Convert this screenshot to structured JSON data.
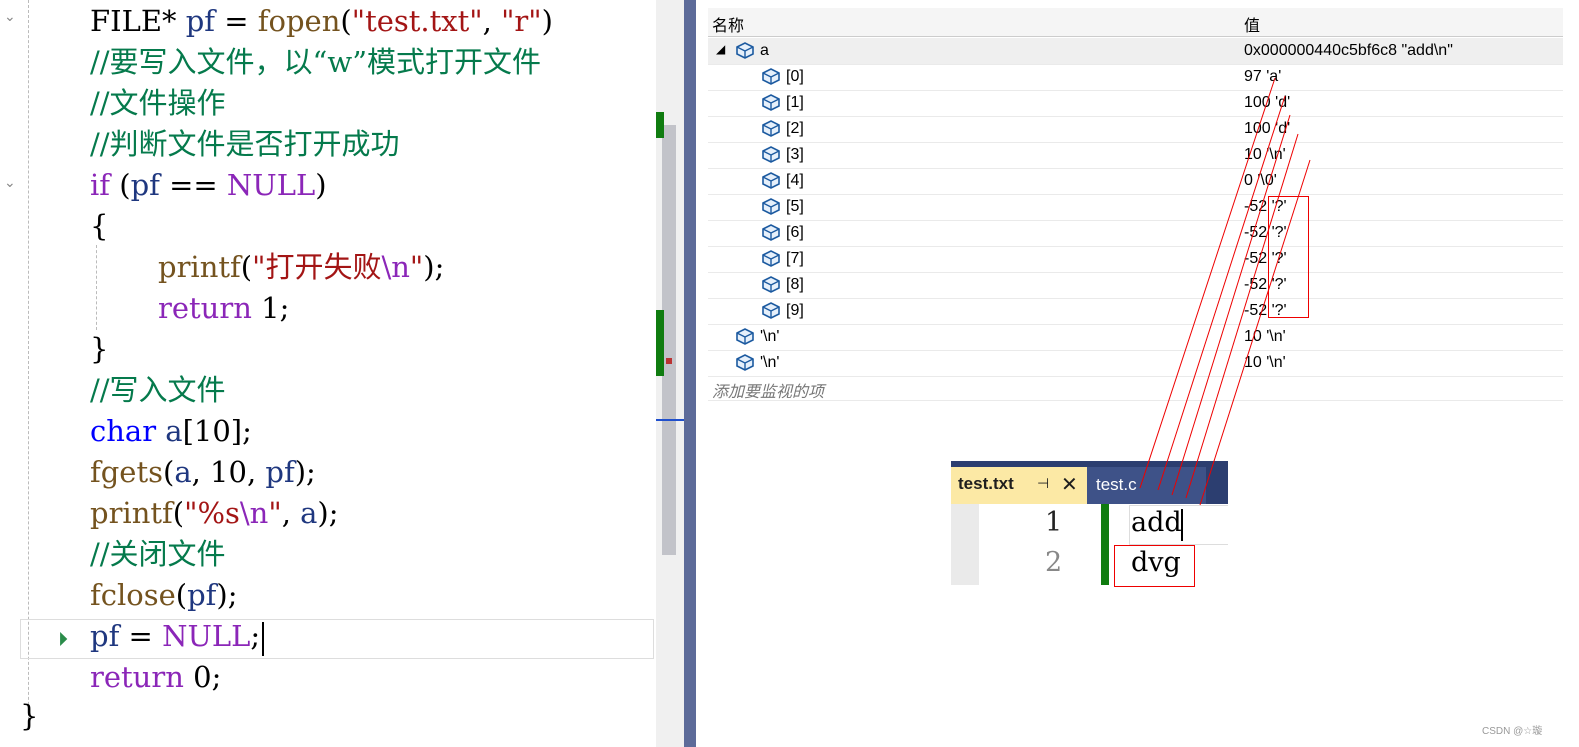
{
  "editor": {
    "lines": [
      [
        {
          "c": "pl",
          "t": "FILE* "
        },
        {
          "c": "id",
          "t": "pf"
        },
        {
          "c": "pl",
          "t": " = "
        },
        {
          "c": "fn",
          "t": "fopen"
        },
        {
          "c": "pl",
          "t": "("
        },
        {
          "c": "str",
          "t": "\"test.txt\""
        },
        {
          "c": "pl",
          "t": ", "
        },
        {
          "c": "str",
          "t": "\"r\""
        },
        {
          "c": "pl",
          "t": ")"
        }
      ],
      [
        {
          "c": "cm",
          "t": "//要写入文件，以“w”模式打开文件"
        }
      ],
      [
        {
          "c": "cm",
          "t": "//文件操作"
        }
      ],
      [
        {
          "c": "cm",
          "t": "//判断文件是否打开成功"
        }
      ],
      [
        {
          "c": "kw",
          "t": "if"
        },
        {
          "c": "pl",
          "t": " ("
        },
        {
          "c": "id",
          "t": "pf"
        },
        {
          "c": "pl",
          "t": " == "
        },
        {
          "c": "mac",
          "t": "NULL"
        },
        {
          "c": "pl",
          "t": ")"
        }
      ],
      [
        {
          "c": "pl",
          "t": "{"
        }
      ],
      [
        {
          "c": "fn",
          "t": "printf"
        },
        {
          "c": "pl",
          "t": "("
        },
        {
          "c": "str",
          "t": "\"打开失败"
        },
        {
          "c": "esc",
          "t": "\\n"
        },
        {
          "c": "str",
          "t": "\""
        },
        {
          "c": "pl",
          "t": ");"
        }
      ],
      [
        {
          "c": "kw",
          "t": "return"
        },
        {
          "c": "pl",
          "t": " 1;"
        }
      ],
      [
        {
          "c": "pl",
          "t": "}"
        }
      ],
      [
        {
          "c": "cm",
          "t": "//写入文件"
        }
      ],
      [
        {
          "c": "ty",
          "t": "char"
        },
        {
          "c": "pl",
          "t": " "
        },
        {
          "c": "id",
          "t": "a"
        },
        {
          "c": "pl",
          "t": "[10];"
        }
      ],
      [
        {
          "c": "fn",
          "t": "fgets"
        },
        {
          "c": "pl",
          "t": "("
        },
        {
          "c": "id",
          "t": "a"
        },
        {
          "c": "pl",
          "t": ", 10, "
        },
        {
          "c": "id",
          "t": "pf"
        },
        {
          "c": "pl",
          "t": ");"
        }
      ],
      [
        {
          "c": "fn",
          "t": "printf"
        },
        {
          "c": "pl",
          "t": "("
        },
        {
          "c": "str",
          "t": "\"%s"
        },
        {
          "c": "esc",
          "t": "\\n"
        },
        {
          "c": "str",
          "t": "\""
        },
        {
          "c": "pl",
          "t": ", "
        },
        {
          "c": "id",
          "t": "a"
        },
        {
          "c": "pl",
          "t": ");"
        }
      ],
      [
        {
          "c": "cm",
          "t": "//关闭文件"
        }
      ],
      [
        {
          "c": "fn",
          "t": "fclose"
        },
        {
          "c": "pl",
          "t": "("
        },
        {
          "c": "id",
          "t": "pf"
        },
        {
          "c": "pl",
          "t": ");"
        }
      ],
      [
        {
          "c": "id",
          "t": "pf"
        },
        {
          "c": "pl",
          "t": " = "
        },
        {
          "c": "mac",
          "t": "NULL"
        },
        {
          "c": "pl",
          "t": ";"
        }
      ],
      [
        {
          "c": "kw",
          "t": "return"
        },
        {
          "c": "pl",
          "t": " 0;"
        }
      ]
    ],
    "closing_brace": "}"
  },
  "watch": {
    "header_name": "名称",
    "header_value": "值",
    "rows": [
      {
        "name": "a",
        "value": "0x000000440c5bf6c8 \"add\\n\""
      },
      {
        "name": "[0]",
        "value": "97 'a'"
      },
      {
        "name": "[1]",
        "value": "100 'd'"
      },
      {
        "name": "[2]",
        "value": "100 'd'"
      },
      {
        "name": "[3]",
        "value": "10 '\\n'"
      },
      {
        "name": "[4]",
        "value": "0 '\\0'"
      },
      {
        "name": "[5]",
        "value": "-52 '?'"
      },
      {
        "name": "[6]",
        "value": "-52 '?'"
      },
      {
        "name": "[7]",
        "value": "-52 '?'"
      },
      {
        "name": "[8]",
        "value": "-52 '?'"
      },
      {
        "name": "[9]",
        "value": "-52 '?'"
      },
      {
        "name": "'\\n'",
        "value": "10 '\\n'"
      },
      {
        "name": "'\\n'",
        "value": "10 '\\n'"
      }
    ],
    "add_item_placeholder": "添加要监视的项"
  },
  "mini_editor": {
    "active_tab": "test.txt",
    "inactive_tab": "test.c",
    "line1_number": "1",
    "line2_number": "2",
    "line1_text": "add",
    "line2_text": "dvg"
  },
  "watermark": "CSDN @☆璇",
  "colors": {
    "accent_green": "#107c10",
    "annotation_red": "#e00000",
    "splitter": "#5d6b99"
  }
}
